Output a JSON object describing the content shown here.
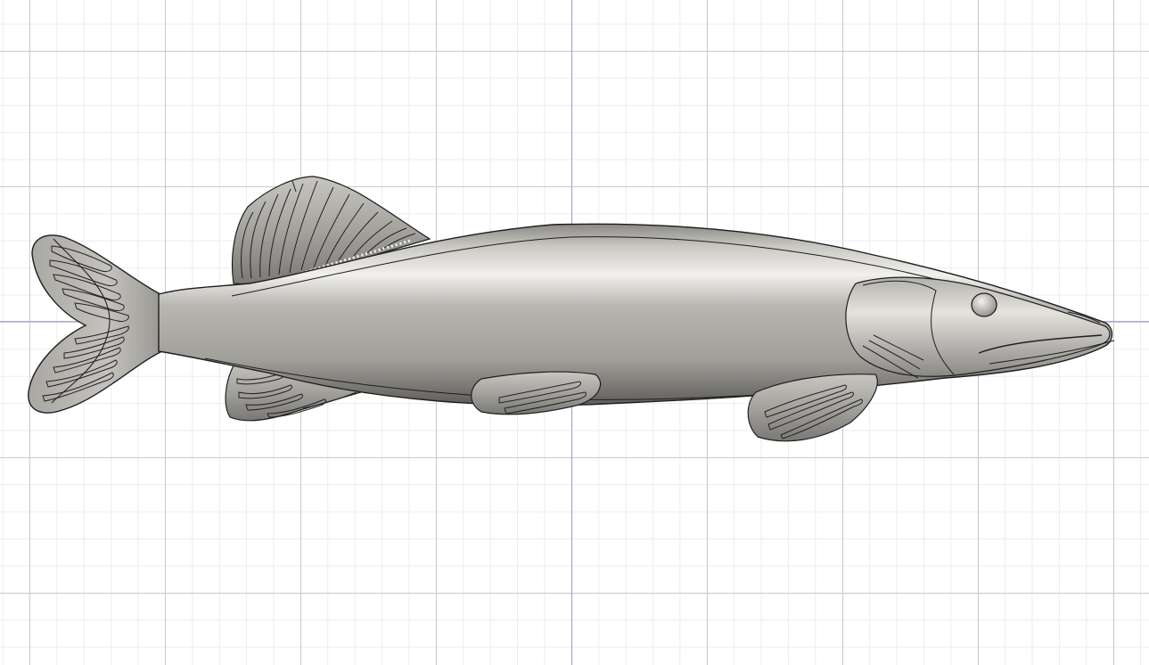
{
  "viewport": {
    "background": "#ffffff",
    "grid_major_color": "#c9c9d1",
    "grid_minor_color": "#ececf0",
    "axis_color": "#9c9cc4"
  },
  "model": {
    "object": "pike-fish-3d-model",
    "material_color": "#9c9a94",
    "edge_color": "#1e1e1e"
  }
}
